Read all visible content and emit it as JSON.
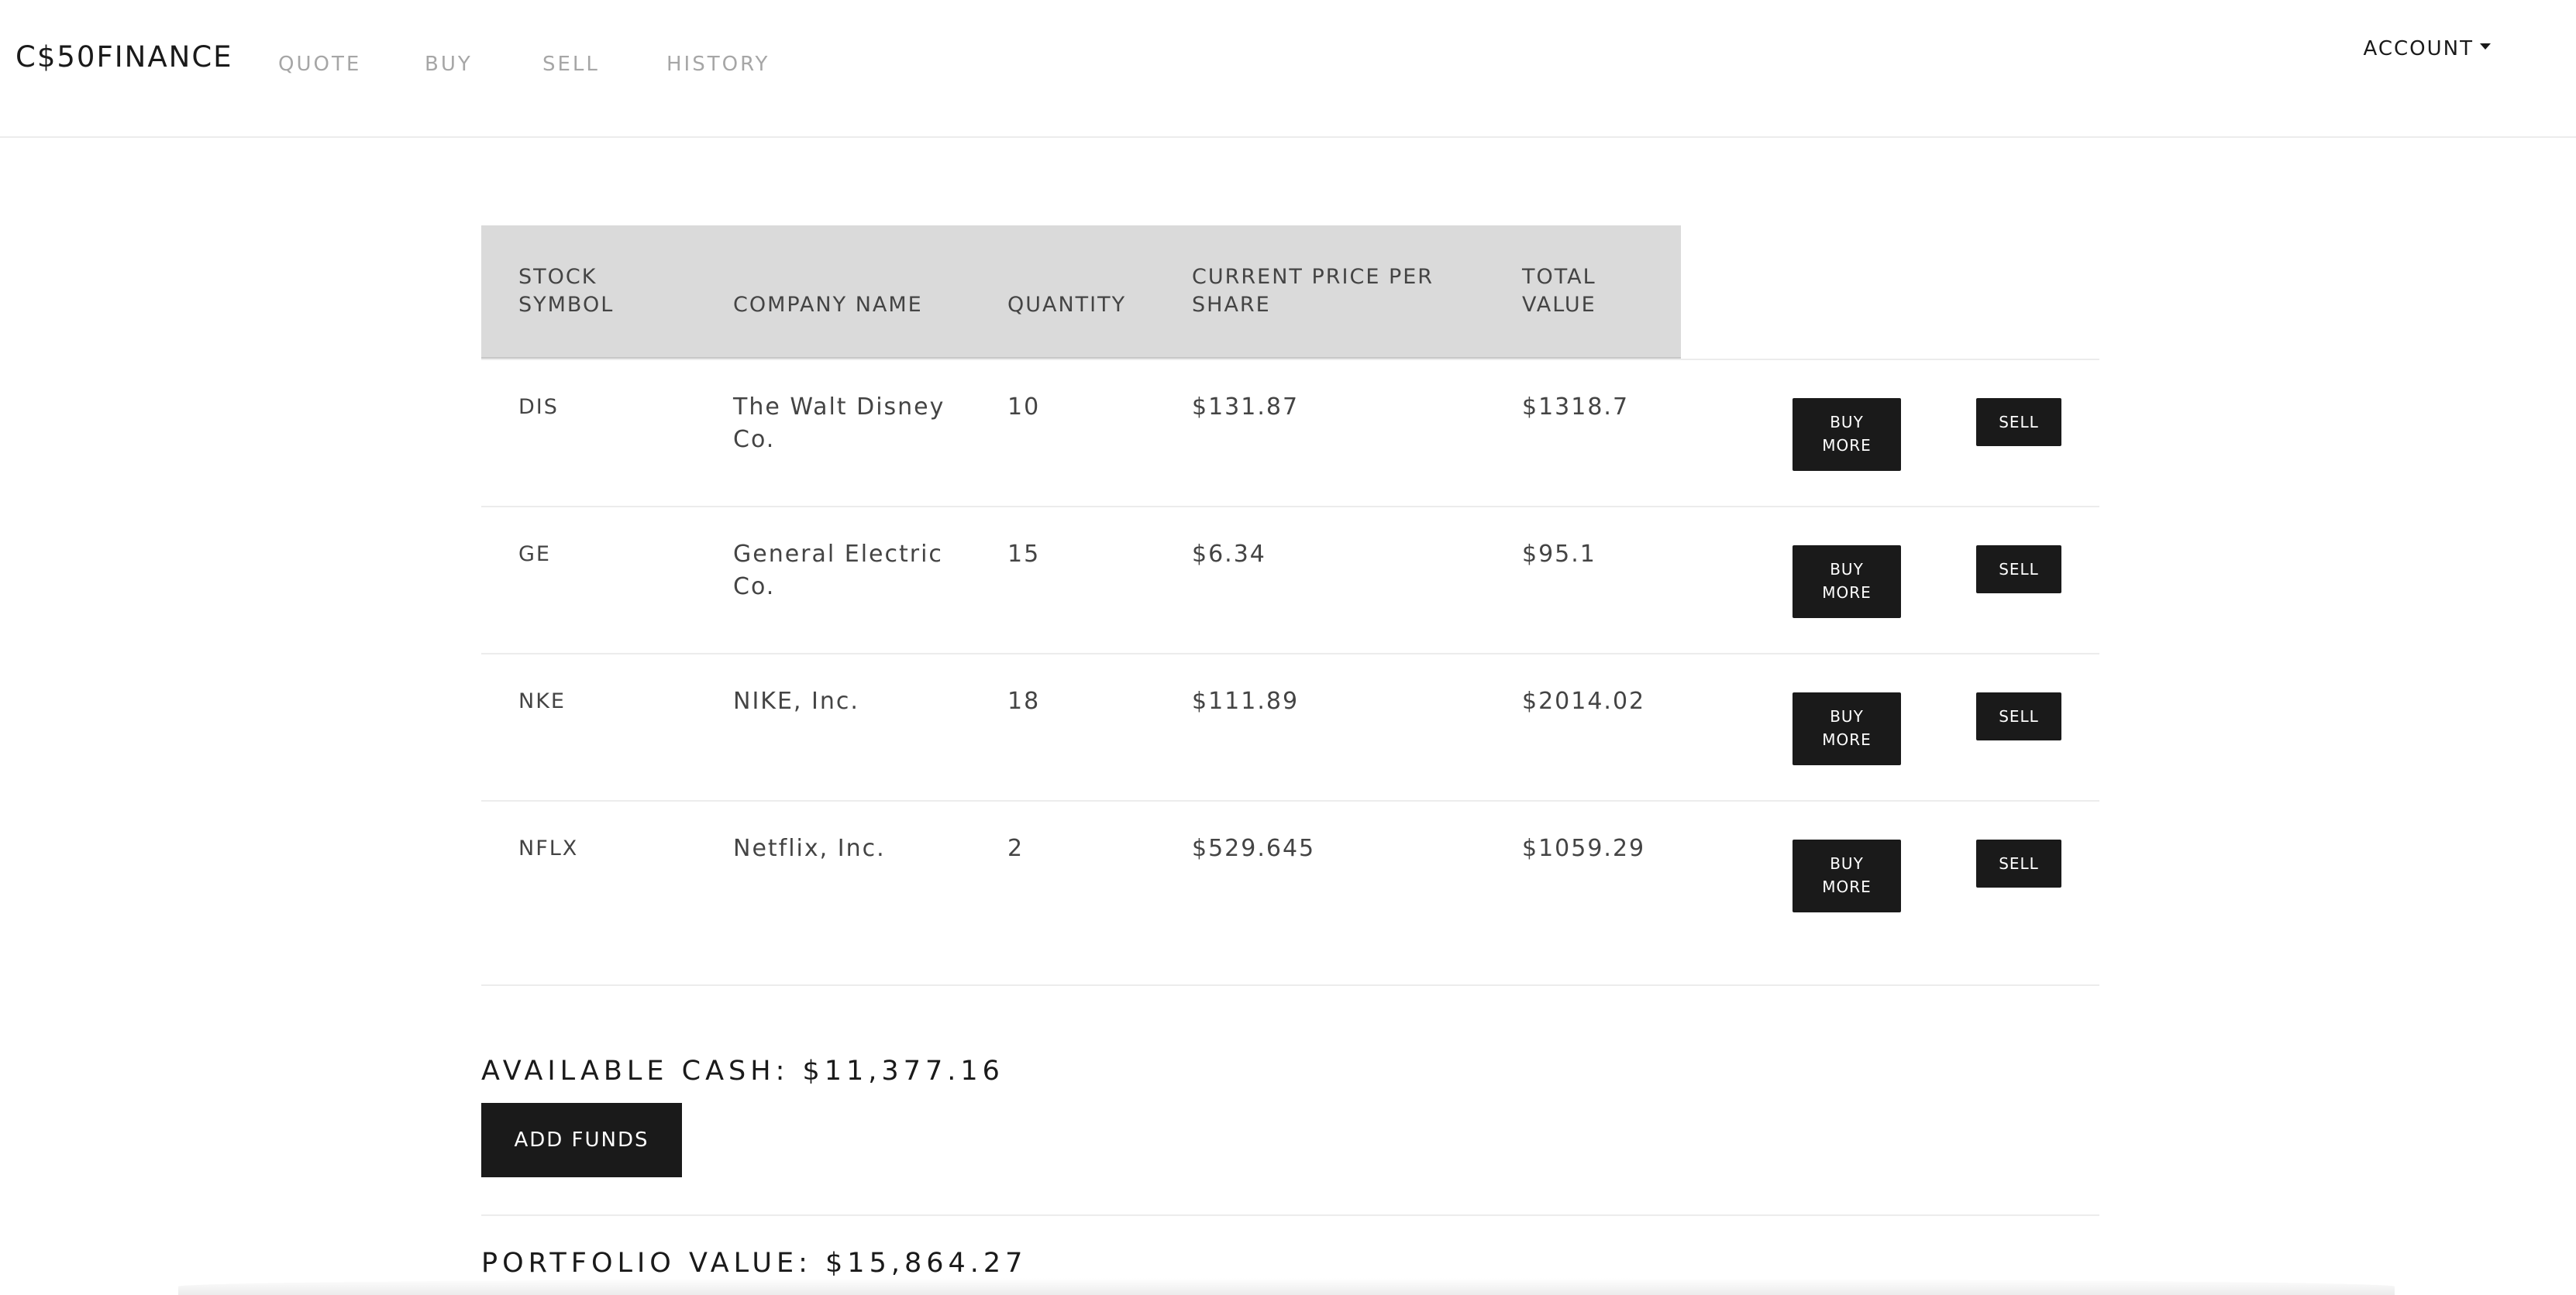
{
  "navbar": {
    "brand": "C$50FINANCE",
    "links": [
      {
        "label": "QUOTE"
      },
      {
        "label": "BUY"
      },
      {
        "label": "SELL"
      },
      {
        "label": "HISTORY"
      }
    ],
    "account_label": "ACCOUNT"
  },
  "table": {
    "headers": {
      "symbol_line1": "STOCK",
      "symbol_line2": "SYMBOL",
      "company": "COMPANY NAME",
      "quantity": "QUANTITY",
      "price_line1": "CURRENT PRICE PER",
      "price_line2": "SHARE",
      "total_line1": "TOTAL",
      "total_line2": "VALUE"
    },
    "rows": [
      {
        "symbol": "DIS",
        "company_line1": "The Walt Disney",
        "company_line2": "Co.",
        "quantity": "10",
        "price": "$131.87",
        "total": "$1318.7"
      },
      {
        "symbol": "GE",
        "company_line1": "General Electric",
        "company_line2": "Co.",
        "quantity": "15",
        "price": "$6.34",
        "total": "$95.1"
      },
      {
        "symbol": "NKE",
        "company_line1": "NIKE, Inc.",
        "company_line2": "",
        "quantity": "18",
        "price": "$111.89",
        "total": "$2014.02"
      },
      {
        "symbol": "NFLX",
        "company_line1": "Netflix, Inc.",
        "company_line2": "",
        "quantity": "2",
        "price": "$529.645",
        "total": "$1059.29"
      }
    ],
    "buy_more_line1": "BUY",
    "buy_more_line2": "MORE",
    "sell_label": "SELL"
  },
  "summary": {
    "available_cash": "AVAILABLE CASH: $11,377.16",
    "add_funds_label": "ADD FUNDS",
    "portfolio_value": "PORTFOLIO VALUE: $15,864.27"
  },
  "colors": {
    "button_bg": "#1a1a1a",
    "header_bg": "#dadada",
    "nav_link": "#a6a6a6"
  }
}
